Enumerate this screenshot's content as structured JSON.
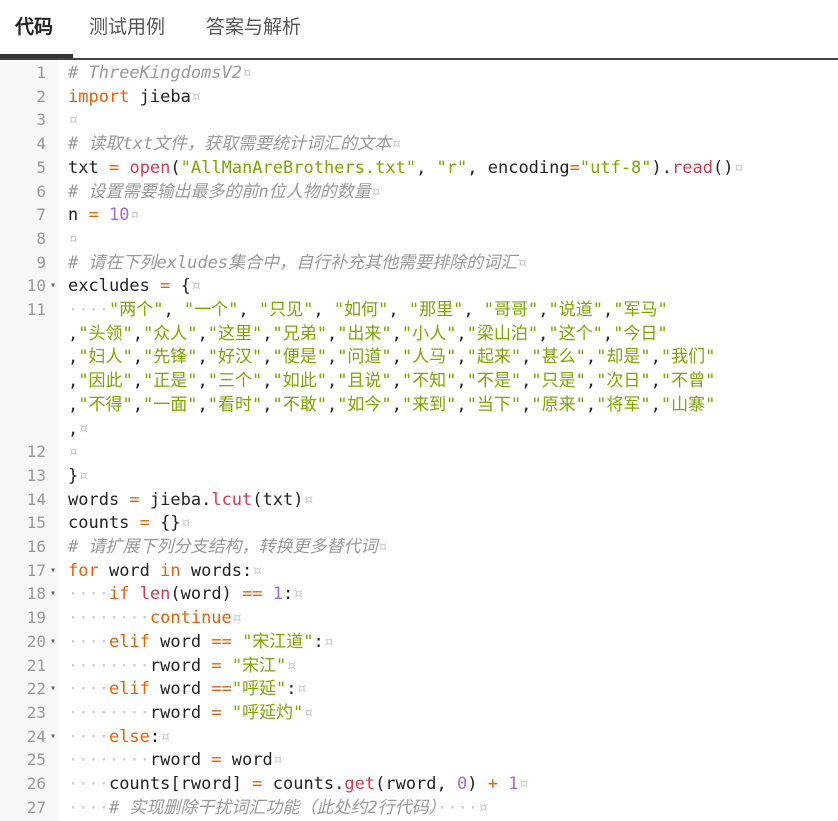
{
  "tabs": [
    "代码",
    "测试用例",
    "答案与解析"
  ],
  "lines": [
    {
      "n": "1",
      "parts": [
        [
          "cm",
          "# ThreeKingdomsV2"
        ],
        [
          "ws",
          "¤"
        ]
      ]
    },
    {
      "n": "2",
      "parts": [
        [
          "kw",
          "import"
        ],
        [
          "t",
          " jieba"
        ],
        [
          "ws",
          "¤"
        ]
      ]
    },
    {
      "n": "3",
      "parts": [
        [
          "ws",
          "¤"
        ]
      ]
    },
    {
      "n": "4",
      "parts": [
        [
          "cm",
          "# 读取txt文件，获取需要统计词汇的文本"
        ],
        [
          "ws",
          "¤"
        ]
      ]
    },
    {
      "n": "5",
      "parts": [
        [
          "t",
          "txt "
        ],
        [
          "op",
          "="
        ],
        [
          "t",
          " "
        ],
        [
          "fn",
          "open"
        ],
        [
          "t",
          "("
        ],
        [
          "str",
          "\"AllManAreBrothers.txt\""
        ],
        [
          "t",
          ", "
        ],
        [
          "str",
          "\"r\""
        ],
        [
          "t",
          ", encoding"
        ],
        [
          "op",
          "="
        ],
        [
          "str",
          "\"utf-8\""
        ],
        [
          "t",
          ")."
        ],
        [
          "fn",
          "read"
        ],
        [
          "t",
          "()"
        ],
        [
          "ws",
          "¤"
        ]
      ]
    },
    {
      "n": "6",
      "parts": [
        [
          "cm",
          "# 设置需要输出最多的前n位人物的数量"
        ],
        [
          "ws",
          "¤"
        ]
      ]
    },
    {
      "n": "7",
      "parts": [
        [
          "t",
          "n "
        ],
        [
          "op",
          "="
        ],
        [
          "t",
          " "
        ],
        [
          "num",
          "10"
        ],
        [
          "ws",
          "¤"
        ]
      ]
    },
    {
      "n": "8",
      "parts": [
        [
          "ws",
          "¤"
        ]
      ]
    },
    {
      "n": "9",
      "parts": [
        [
          "cm",
          "# 请在下列exludes集合中，自行补充其他需要排除的词汇"
        ],
        [
          "ws",
          "¤"
        ]
      ]
    },
    {
      "n": "10",
      "fold": true,
      "parts": [
        [
          "t",
          "excludes "
        ],
        [
          "op",
          "="
        ],
        [
          "t",
          " {"
        ],
        [
          "ws",
          "¤"
        ]
      ]
    },
    {
      "n": "11",
      "parts": [
        [
          "ws",
          "····"
        ],
        [
          "str",
          "\"两个\""
        ],
        [
          "t",
          ", "
        ],
        [
          "str",
          "\"一个\""
        ],
        [
          "t",
          ", "
        ],
        [
          "str",
          "\"只见\""
        ],
        [
          "t",
          ", "
        ],
        [
          "str",
          "\"如何\""
        ],
        [
          "t",
          ", "
        ],
        [
          "str",
          "\"那里\""
        ],
        [
          "t",
          ", "
        ],
        [
          "str",
          "\"哥哥\""
        ],
        [
          "t",
          ","
        ],
        [
          "str",
          "\"说道\""
        ],
        [
          "t",
          ","
        ],
        [
          "str",
          "\"军马\""
        ]
      ]
    },
    {
      "n": "",
      "parts": [
        [
          "t",
          ","
        ],
        [
          "str",
          "\"头领\""
        ],
        [
          "t",
          ","
        ],
        [
          "str",
          "\"众人\""
        ],
        [
          "t",
          ","
        ],
        [
          "str",
          "\"这里\""
        ],
        [
          "t",
          ","
        ],
        [
          "str",
          "\"兄弟\""
        ],
        [
          "t",
          ","
        ],
        [
          "str",
          "\"出来\""
        ],
        [
          "t",
          ","
        ],
        [
          "str",
          "\"小人\""
        ],
        [
          "t",
          ","
        ],
        [
          "str",
          "\"梁山泊\""
        ],
        [
          "t",
          ","
        ],
        [
          "str",
          "\"这个\""
        ],
        [
          "t",
          ","
        ],
        [
          "str",
          "\"今日\""
        ]
      ]
    },
    {
      "n": "",
      "parts": [
        [
          "t",
          ","
        ],
        [
          "str",
          "\"妇人\""
        ],
        [
          "t",
          ","
        ],
        [
          "str",
          "\"先锋\""
        ],
        [
          "t",
          ","
        ],
        [
          "str",
          "\"好汉\""
        ],
        [
          "t",
          ","
        ],
        [
          "str",
          "\"便是\""
        ],
        [
          "t",
          ","
        ],
        [
          "str",
          "\"问道\""
        ],
        [
          "t",
          ","
        ],
        [
          "str",
          "\"人马\""
        ],
        [
          "t",
          ","
        ],
        [
          "str",
          "\"起来\""
        ],
        [
          "t",
          ","
        ],
        [
          "str",
          "\"甚么\""
        ],
        [
          "t",
          ","
        ],
        [
          "str",
          "\"却是\""
        ],
        [
          "t",
          ","
        ],
        [
          "str",
          "\"我们\""
        ]
      ]
    },
    {
      "n": "",
      "parts": [
        [
          "t",
          ","
        ],
        [
          "str",
          "\"因此\""
        ],
        [
          "t",
          ","
        ],
        [
          "str",
          "\"正是\""
        ],
        [
          "t",
          ","
        ],
        [
          "str",
          "\"三个\""
        ],
        [
          "t",
          ","
        ],
        [
          "str",
          "\"如此\""
        ],
        [
          "t",
          ","
        ],
        [
          "str",
          "\"且说\""
        ],
        [
          "t",
          ","
        ],
        [
          "str",
          "\"不知\""
        ],
        [
          "t",
          ","
        ],
        [
          "str",
          "\"不是\""
        ],
        [
          "t",
          ","
        ],
        [
          "str",
          "\"只是\""
        ],
        [
          "t",
          ","
        ],
        [
          "str",
          "\"次日\""
        ],
        [
          "t",
          ","
        ],
        [
          "str",
          "\"不曾\""
        ]
      ]
    },
    {
      "n": "",
      "parts": [
        [
          "t",
          ","
        ],
        [
          "str",
          "\"不得\""
        ],
        [
          "t",
          ","
        ],
        [
          "str",
          "\"一面\""
        ],
        [
          "t",
          ","
        ],
        [
          "str",
          "\"看时\""
        ],
        [
          "t",
          ","
        ],
        [
          "str",
          "\"不敢\""
        ],
        [
          "t",
          ","
        ],
        [
          "str",
          "\"如今\""
        ],
        [
          "t",
          ","
        ],
        [
          "str",
          "\"来到\""
        ],
        [
          "t",
          ","
        ],
        [
          "str",
          "\"当下\""
        ],
        [
          "t",
          ","
        ],
        [
          "str",
          "\"原来\""
        ],
        [
          "t",
          ","
        ],
        [
          "str",
          "\"将军\""
        ],
        [
          "t",
          ","
        ],
        [
          "str",
          "\"山寨\""
        ]
      ]
    },
    {
      "n": "",
      "parts": [
        [
          "t",
          ","
        ],
        [
          "ws",
          "¤"
        ]
      ]
    },
    {
      "n": "12",
      "parts": [
        [
          "ws",
          "¤"
        ]
      ]
    },
    {
      "n": "13",
      "parts": [
        [
          "t",
          "}"
        ],
        [
          "ws",
          "¤"
        ]
      ]
    },
    {
      "n": "14",
      "parts": [
        [
          "t",
          "words "
        ],
        [
          "op",
          "="
        ],
        [
          "t",
          " jieba."
        ],
        [
          "fn",
          "lcut"
        ],
        [
          "t",
          "(txt)"
        ],
        [
          "ws",
          "¤"
        ]
      ]
    },
    {
      "n": "15",
      "parts": [
        [
          "t",
          "counts "
        ],
        [
          "op",
          "="
        ],
        [
          "t",
          " {}"
        ],
        [
          "ws",
          "¤"
        ]
      ]
    },
    {
      "n": "16",
      "parts": [
        [
          "cm",
          "# 请扩展下列分支结构，转换更多替代词"
        ],
        [
          "ws",
          "¤"
        ]
      ]
    },
    {
      "n": "17",
      "fold": true,
      "parts": [
        [
          "kw",
          "for"
        ],
        [
          "t",
          " word "
        ],
        [
          "kw",
          "in"
        ],
        [
          "t",
          " words:"
        ],
        [
          "ws",
          "¤"
        ]
      ]
    },
    {
      "n": "18",
      "fold": true,
      "parts": [
        [
          "ws",
          "····"
        ],
        [
          "kw",
          "if"
        ],
        [
          "t",
          " "
        ],
        [
          "fn",
          "len"
        ],
        [
          "t",
          "(word) "
        ],
        [
          "op",
          "=="
        ],
        [
          "t",
          " "
        ],
        [
          "num",
          "1"
        ],
        [
          "t",
          ":"
        ],
        [
          "ws",
          "¤"
        ]
      ]
    },
    {
      "n": "19",
      "parts": [
        [
          "ws",
          "········"
        ],
        [
          "kw",
          "continue"
        ],
        [
          "ws",
          "¤"
        ]
      ]
    },
    {
      "n": "20",
      "fold": true,
      "parts": [
        [
          "ws",
          "····"
        ],
        [
          "kw",
          "elif"
        ],
        [
          "t",
          " word "
        ],
        [
          "op",
          "=="
        ],
        [
          "t",
          " "
        ],
        [
          "str",
          "\"宋江道\""
        ],
        [
          "t",
          ":"
        ],
        [
          "ws",
          "¤"
        ]
      ]
    },
    {
      "n": "21",
      "parts": [
        [
          "ws",
          "········"
        ],
        [
          "t",
          "rword "
        ],
        [
          "op",
          "="
        ],
        [
          "t",
          " "
        ],
        [
          "str",
          "\"宋江\""
        ],
        [
          "ws",
          "¤"
        ]
      ]
    },
    {
      "n": "22",
      "fold": true,
      "parts": [
        [
          "ws",
          "····"
        ],
        [
          "kw",
          "elif"
        ],
        [
          "t",
          " word "
        ],
        [
          "op",
          "=="
        ],
        [
          "str",
          "\"呼延\""
        ],
        [
          "t",
          ":"
        ],
        [
          "ws",
          "¤"
        ]
      ]
    },
    {
      "n": "23",
      "parts": [
        [
          "ws",
          "········"
        ],
        [
          "t",
          "rword "
        ],
        [
          "op",
          "="
        ],
        [
          "t",
          " "
        ],
        [
          "str",
          "\"呼延灼\""
        ],
        [
          "ws",
          "¤"
        ]
      ]
    },
    {
      "n": "24",
      "fold": true,
      "parts": [
        [
          "ws",
          "····"
        ],
        [
          "kw",
          "else"
        ],
        [
          "t",
          ":"
        ],
        [
          "ws",
          "¤"
        ]
      ]
    },
    {
      "n": "25",
      "parts": [
        [
          "ws",
          "········"
        ],
        [
          "t",
          "rword "
        ],
        [
          "op",
          "="
        ],
        [
          "t",
          " word"
        ],
        [
          "ws",
          "¤"
        ]
      ]
    },
    {
      "n": "26",
      "parts": [
        [
          "ws",
          "····"
        ],
        [
          "t",
          "counts[rword] "
        ],
        [
          "op",
          "="
        ],
        [
          "t",
          " counts."
        ],
        [
          "fn",
          "get"
        ],
        [
          "t",
          "(rword, "
        ],
        [
          "num",
          "0"
        ],
        [
          "t",
          ") "
        ],
        [
          "op",
          "+"
        ],
        [
          "t",
          " "
        ],
        [
          "num",
          "1"
        ],
        [
          "ws",
          "¤"
        ]
      ]
    },
    {
      "n": "27",
      "parts": [
        [
          "ws",
          "····"
        ],
        [
          "cm",
          "# 实现删除干扰词汇功能（此处约2行代码）"
        ],
        [
          "ws",
          "····¤"
        ]
      ]
    }
  ]
}
